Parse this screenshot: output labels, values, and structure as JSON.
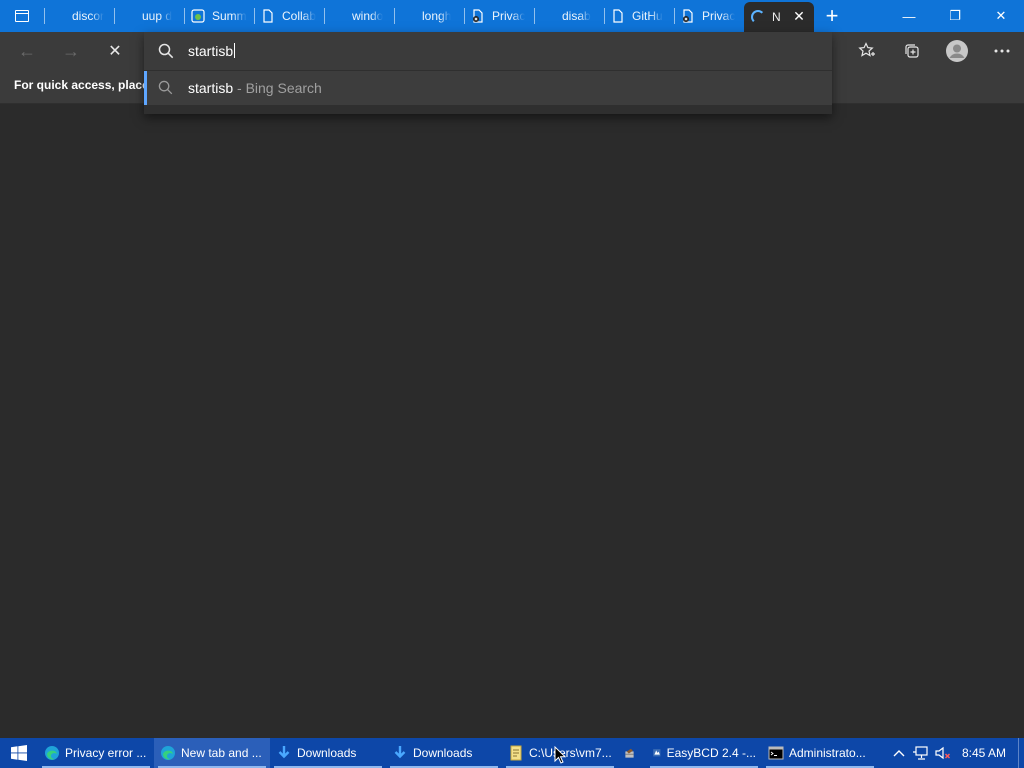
{
  "browser": {
    "tabs": [
      {
        "label": "discor",
        "icon": "blank"
      },
      {
        "label": "uup d",
        "icon": "blank"
      },
      {
        "label": "Summ",
        "icon": "green-icon"
      },
      {
        "label": "Collab",
        "icon": "page-icon"
      },
      {
        "label": "windo",
        "icon": "blank"
      },
      {
        "label": "longh",
        "icon": "blank"
      },
      {
        "label": "Privac",
        "icon": "error-page-icon"
      },
      {
        "label": "disab",
        "icon": "blank"
      },
      {
        "label": "GitHu",
        "icon": "page-icon"
      },
      {
        "label": "Privac",
        "icon": "error-page-icon"
      }
    ],
    "active_tab": {
      "label": "N",
      "state": "loading"
    },
    "window_controls": {
      "minimize": "—",
      "restore": "❐",
      "close": "✕"
    }
  },
  "toolbar": {
    "back_icon": "←",
    "forward_icon": "→",
    "stop_icon": "✕"
  },
  "omnibox": {
    "value": "startisb",
    "suggestion": {
      "main": "startisb",
      "sub": " - Bing Search"
    }
  },
  "favorites_bar": {
    "text": "For quick access, place y"
  },
  "taskbar": {
    "items": [
      {
        "label": "Privacy error ...",
        "icon": "edge-icon",
        "active": false
      },
      {
        "label": "New tab and ...",
        "icon": "edge-icon",
        "active": true
      },
      {
        "label": "Downloads",
        "icon": "download-arrow-icon",
        "active": false
      },
      {
        "label": "Downloads",
        "icon": "download-arrow-icon",
        "active": false
      },
      {
        "label": "C:\\Users\\vm7...",
        "icon": "notepad-icon",
        "active": false
      },
      {
        "label": "",
        "icon": "tools-icon",
        "active": false
      },
      {
        "label": "EasyBCD 2.4 -...",
        "icon": "easybcd-icon",
        "active": false
      },
      {
        "label": "Administrato...",
        "icon": "cmd-icon",
        "active": false
      }
    ],
    "clock": "8:45 AM",
    "colors": {
      "taskbar": "#0d47a8",
      "accent": "#0f74d8"
    }
  }
}
